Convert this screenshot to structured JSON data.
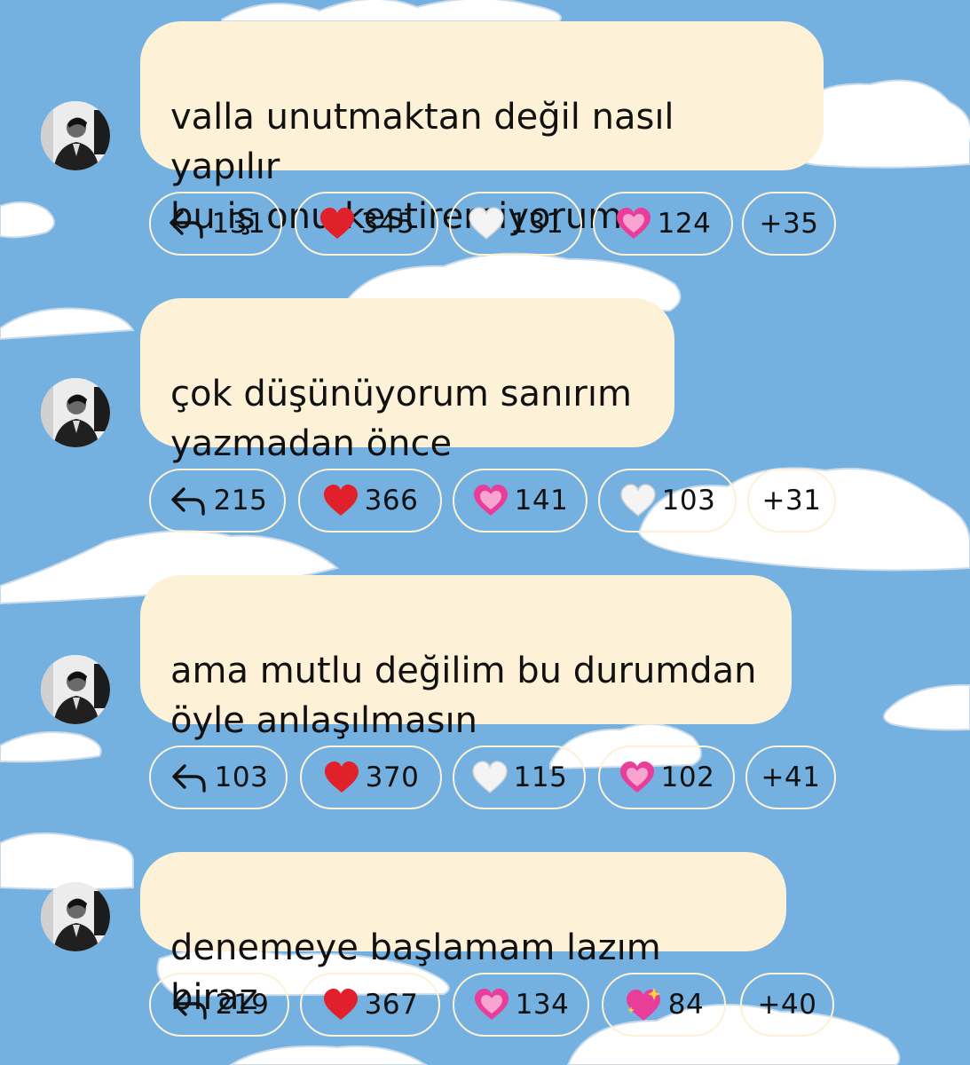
{
  "colors": {
    "sky": "#74b1e0",
    "bubble": "#fdf2d8",
    "text": "#111111",
    "cloud": "#ffffff"
  },
  "messages": [
    {
      "text": "valla unutmaktan değil nasıl yapılır\nbu iş onu kestiremiyorum",
      "reactions": [
        {
          "icon": "reply-icon",
          "count": "131"
        },
        {
          "icon": "red-heart-icon",
          "count": "345"
        },
        {
          "icon": "white-heart-icon",
          "count": "131"
        },
        {
          "icon": "pink-heart-icon",
          "count": "124"
        },
        {
          "icon": "more-reactions",
          "count": "+35"
        }
      ]
    },
    {
      "text": "çok düşünüyorum sanırım\nyazmadan önce",
      "reactions": [
        {
          "icon": "reply-icon",
          "count": "215"
        },
        {
          "icon": "red-heart-icon",
          "count": "366"
        },
        {
          "icon": "pink-heart-icon",
          "count": "141"
        },
        {
          "icon": "white-heart-icon",
          "count": "103"
        },
        {
          "icon": "more-reactions",
          "count": "+31"
        }
      ]
    },
    {
      "text": "ama mutlu değilim bu durumdan\nöyle anlaşılmasın",
      "reactions": [
        {
          "icon": "reply-icon",
          "count": "103"
        },
        {
          "icon": "red-heart-icon",
          "count": "370"
        },
        {
          "icon": "white-heart-icon",
          "count": "115"
        },
        {
          "icon": "pink-heart-icon",
          "count": "102"
        },
        {
          "icon": "more-reactions",
          "count": "+41"
        }
      ]
    },
    {
      "text": "denemeye başlamam lazım biraz",
      "reactions": [
        {
          "icon": "reply-icon",
          "count": "219"
        },
        {
          "icon": "red-heart-icon",
          "count": "367"
        },
        {
          "icon": "pink-heart-icon",
          "count": "134"
        },
        {
          "icon": "sparkling-heart-icon",
          "count": "84"
        },
        {
          "icon": "more-reactions",
          "count": "+40"
        }
      ]
    }
  ]
}
